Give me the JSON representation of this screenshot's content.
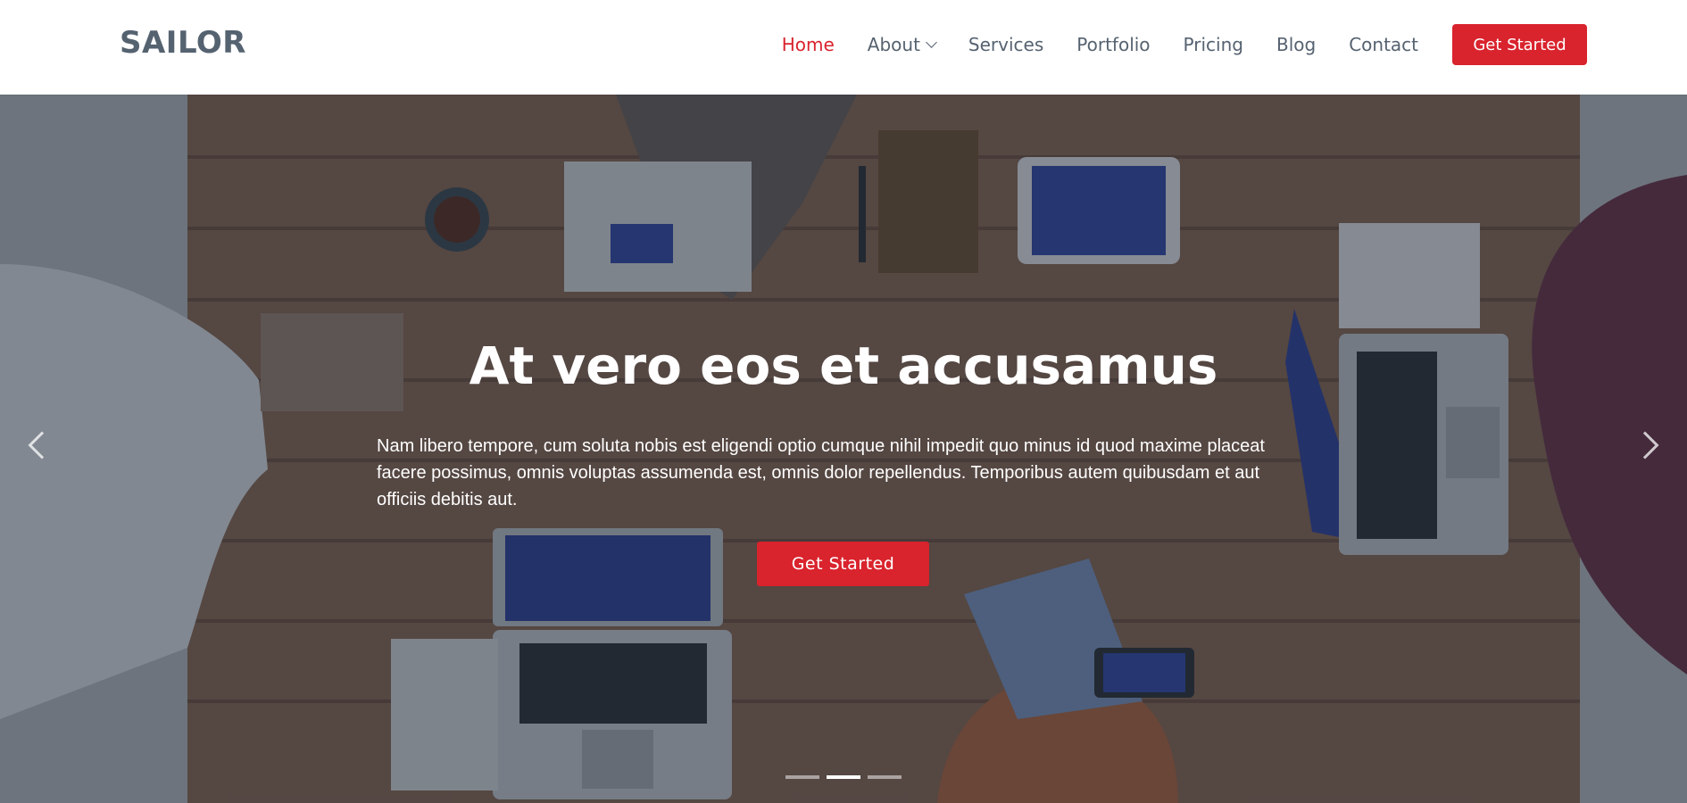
{
  "brand": {
    "logo": "SAILOR"
  },
  "nav": {
    "items": [
      {
        "label": "Home",
        "active": true
      },
      {
        "label": "About",
        "dropdown": true
      },
      {
        "label": "Services"
      },
      {
        "label": "Portfolio"
      },
      {
        "label": "Pricing"
      },
      {
        "label": "Blog"
      },
      {
        "label": "Contact"
      }
    ],
    "cta_label": "Get Started"
  },
  "hero": {
    "title": "At vero eos et accusamus",
    "text": "Nam libero tempore, cum soluta nobis est eligendi optio cumque nihil impedit quo minus id quod maxime placeat facere possimus, omnis voluptas assumenda est, omnis dolor repellendus. Temporibus autem quibusdam et aut officiis debitis aut.",
    "button_label": "Get Started",
    "active_slide": 2,
    "slide_count": 3
  },
  "colors": {
    "accent": "#d9232d",
    "nav_text": "#556270",
    "overlay": "rgba(28, 38, 52, 0.48)"
  },
  "icons": {
    "prev": "chevron-left-icon",
    "next": "chevron-right-icon",
    "dropdown": "chevron-down-icon"
  }
}
